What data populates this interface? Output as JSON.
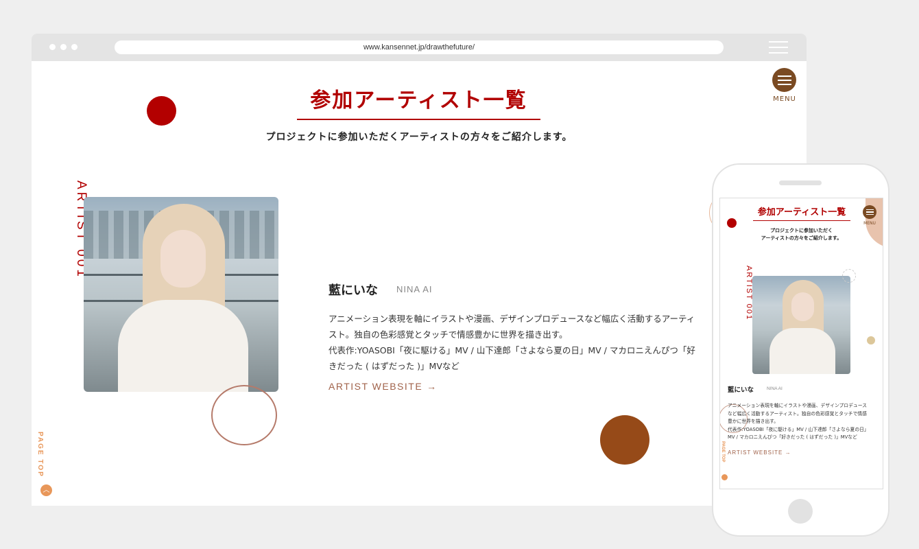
{
  "browser": {
    "url": "www.kansennet.jp/drawthefuture/"
  },
  "page": {
    "title": "参加アーティスト一覧",
    "lead": "プロジェクトに参加いただくアーティストの方々をご紹介します。",
    "menu_label": "MENU",
    "page_top_label": "PAGE TOP",
    "page_top_icon": "chevron-up-icon"
  },
  "artist": {
    "number_label": "ARTIST 001",
    "name_ja": "藍にいな",
    "name_en": "NINA AI",
    "description": [
      "アニメーション表現を軸にイラストや漫画、デザインプロデュースなど幅広く活動するアーティ",
      "スト。独自の色彩感覚とタッチで情感豊かに世界を描き出す。",
      "代表作:YOASOBI「夜に駆ける」MV / 山下達郎「さよなら夏の日」MV / マカロニえんぴつ「好",
      "きだった ( はずだった )」MVなど"
    ],
    "website_label": "ARTIST WEBSITE",
    "website_arrow": "→"
  },
  "mobile": {
    "title": "参加アーティスト一覧",
    "menu_label": "MENU",
    "lead": [
      "プロジェクトに参加いただく",
      "アーティストの方々をご紹介します。"
    ],
    "number_label": "ARTIST 001",
    "name_ja": "藍にいな",
    "name_en": "NINA AI",
    "description": [
      "アニメーション表現を軸にイラストや漫画、デザインプロデュース",
      "など幅広く活動するアーティスト。独自の色彩感覚とタッチで情感",
      "豊かに世界を描き出す。",
      "代表作:YOASOBI「夜に駆ける」MV / 山下達郎「さよなら夏の日」",
      "MV / マカロニえんぴつ「好きだった ( はずだった )」MVなど"
    ],
    "website_label": "ARTIST WEBSITE →",
    "page_top_label": "PAGE TOP"
  },
  "colors": {
    "accent_red": "#b10000",
    "brown": "#964a18",
    "menu_brown": "#7a4a22",
    "orange": "#e8975a",
    "link": "#a0624a"
  }
}
